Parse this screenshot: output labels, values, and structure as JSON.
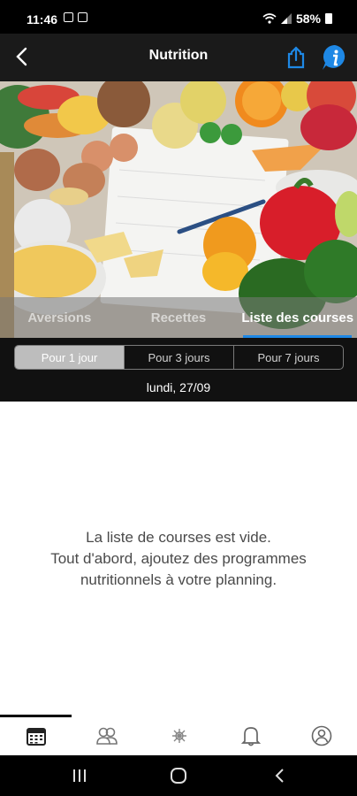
{
  "status_bar": {
    "time": "11:46",
    "battery": "58%"
  },
  "header": {
    "title": "Nutrition"
  },
  "tabs": [
    {
      "label": "Aversions"
    },
    {
      "label": "Recettes"
    },
    {
      "label": "Liste des courses"
    }
  ],
  "active_tab": "Liste des courses",
  "period_selector": {
    "options": [
      {
        "label": "Pour 1 jour"
      },
      {
        "label": "Pour 3 jours"
      },
      {
        "label": "Pour 7 jours"
      }
    ],
    "selected": "Pour 1 jour"
  },
  "date": "lundi, 27/09",
  "empty_state": {
    "line1": "La liste de courses est vide.",
    "line2": "Tout d'abord, ajoutez des programmes",
    "line3": "nutritionnels à votre planning."
  },
  "bottom_nav": {
    "items": [
      "calendar-icon",
      "community-icon",
      "activity-icon",
      "bell-icon",
      "profile-icon"
    ],
    "active": "calendar-icon"
  },
  "colors": {
    "accent": "#1e88e5",
    "header_bg": "#1a1a1a",
    "info": "#1e88e5"
  }
}
